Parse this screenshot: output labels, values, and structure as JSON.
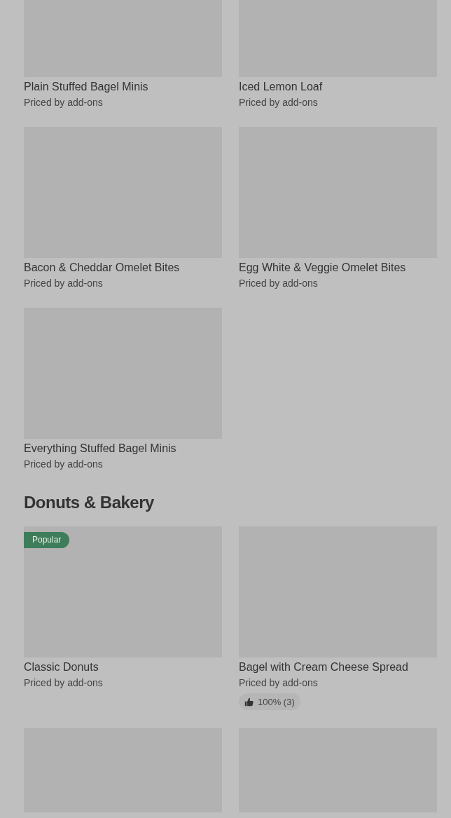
{
  "sections": [
    {
      "items": [
        {
          "name": "Plain Stuffed Bagel Minis",
          "subtitle": "Priced by add-ons"
        },
        {
          "name": "Iced Lemon Loaf",
          "subtitle": "Priced by add-ons"
        },
        {
          "name": "Bacon & Cheddar Omelet Bites",
          "subtitle": "Priced by add-ons"
        },
        {
          "name": "Egg White & Veggie Omelet Bites",
          "subtitle": "Priced by add-ons"
        },
        {
          "name": "Everything Stuffed Bagel Minis",
          "subtitle": "Priced by add-ons"
        }
      ]
    },
    {
      "title": "Donuts & Bakery",
      "items": [
        {
          "name": "Classic Donuts",
          "subtitle": "Priced by add-ons",
          "badge": "Popular"
        },
        {
          "name": "Bagel with Cream Cheese Spread",
          "subtitle": "Priced by add-ons",
          "rating": "100% (3)"
        },
        {
          "kind": "picture"
        },
        {
          "kind": "picture"
        }
      ]
    }
  ]
}
